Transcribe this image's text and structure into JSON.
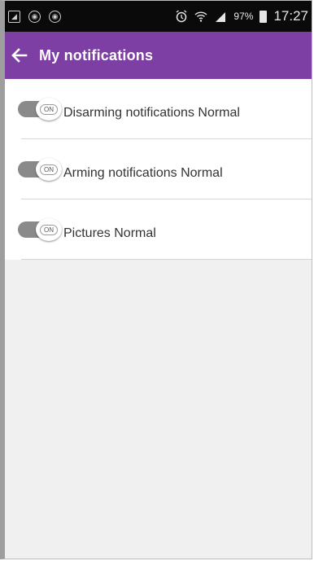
{
  "status_bar": {
    "battery": "97%",
    "time": "17:27",
    "left_icons": [
      "image-notification-icon",
      "app-notification-icon",
      "app-notification-icon"
    ],
    "right_icons": [
      "alarm-icon",
      "wifi-icon",
      "signal-icon",
      "battery-icon"
    ]
  },
  "app_bar": {
    "title": "My notifications",
    "back_icon": "arrow-left-icon",
    "color": "#7e3fa4"
  },
  "notifications": [
    {
      "label": "Disarming notifications Normal",
      "toggle_text": "ON",
      "state": "on"
    },
    {
      "label": "Arming notifications Normal",
      "toggle_text": "ON",
      "state": "on"
    },
    {
      "label": "Pictures Normal",
      "toggle_text": "ON",
      "state": "on"
    }
  ]
}
